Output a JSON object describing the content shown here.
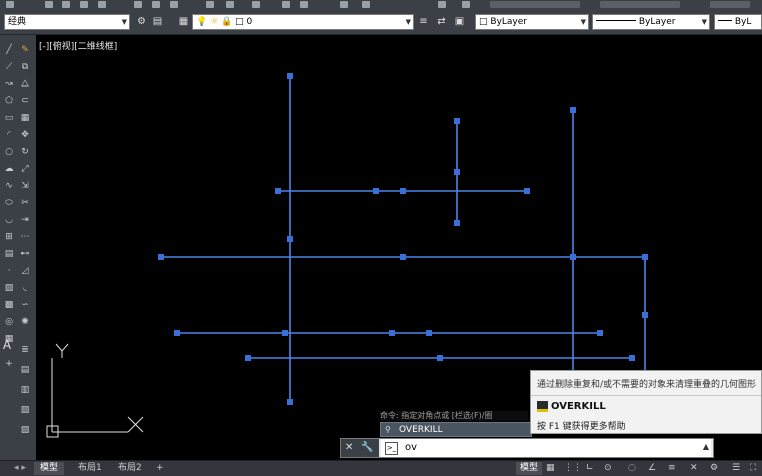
{
  "toolbar": {
    "workspace": "经典",
    "layer": "0",
    "color": "ByLayer",
    "linetype": "ByLayer",
    "lineweight": "ByL"
  },
  "viewport": {
    "label": "[-][俯视][二维线框]"
  },
  "layout_tabs": [
    "模型",
    "布局1",
    "布局2",
    "+"
  ],
  "status": {
    "model": "模型"
  },
  "command": {
    "history": "命令: 指定对角点或 [栏选(F)/圈",
    "input": "ov",
    "suggestion": "OVERKILL"
  },
  "tooltip": {
    "description": "通过删除重复和/或不需要的对象来清理重叠的几何图形",
    "name": "OVERKILL",
    "help": "按 F1 键获得更多帮助"
  },
  "icons": {
    "left_toolbar": [
      "line-icon",
      "pline-icon",
      "polygon-icon",
      "rect-icon",
      "arc-icon",
      "circle-icon",
      "revcloud-icon",
      "spline-icon",
      "ellipse-icon",
      "insert-icon",
      "point-icon",
      "hatch-icon",
      "table-icon",
      "text-icon"
    ],
    "accent": "#4a86e8"
  }
}
